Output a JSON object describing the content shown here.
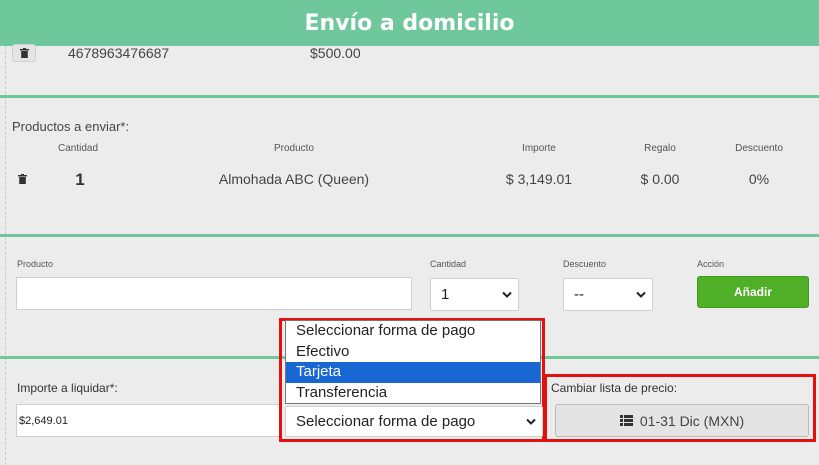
{
  "header": {
    "title": "Envío a domicilio"
  },
  "top_row": {
    "code": "4678963476687",
    "amount": "$500.00"
  },
  "products": {
    "label": "Productos a enviar*:",
    "columns": {
      "cantidad": "Cantidad",
      "producto": "Producto",
      "importe": "Importe",
      "regalo": "Regalo",
      "descuento": "Descuento"
    },
    "rows": [
      {
        "cantidad": "1",
        "producto": "Almohada ABC (Queen)",
        "importe": "$ 3,149.01",
        "regalo": "$ 0.00",
        "descuento": "0%"
      }
    ]
  },
  "add_form": {
    "producto_label": "Producto",
    "producto_value": "",
    "cantidad_label": "Cantidad",
    "cantidad_value": "1",
    "descuento_label": "Descuento",
    "descuento_value": "--",
    "accion_label": "Acción",
    "add_button": "Añadir"
  },
  "payment": {
    "importe_label": "Importe a liquidar*:",
    "importe_value": "$2,649.01",
    "forma_pago_selected": "Seleccionar forma de pago",
    "forma_pago_options": [
      "Seleccionar forma de pago",
      "Efectivo",
      "Tarjeta",
      "Transferencia"
    ],
    "highlighted_option": "Tarjeta"
  },
  "price_list": {
    "label": "Cambiar lista de precio:",
    "button": "01-31 Dic (MXN)",
    "icon": "list-icon"
  },
  "colors": {
    "header_green": "#6fc89b",
    "button_green": "#4fb028",
    "highlight_red": "#e41010",
    "selected_option_blue": "#1967d2"
  }
}
